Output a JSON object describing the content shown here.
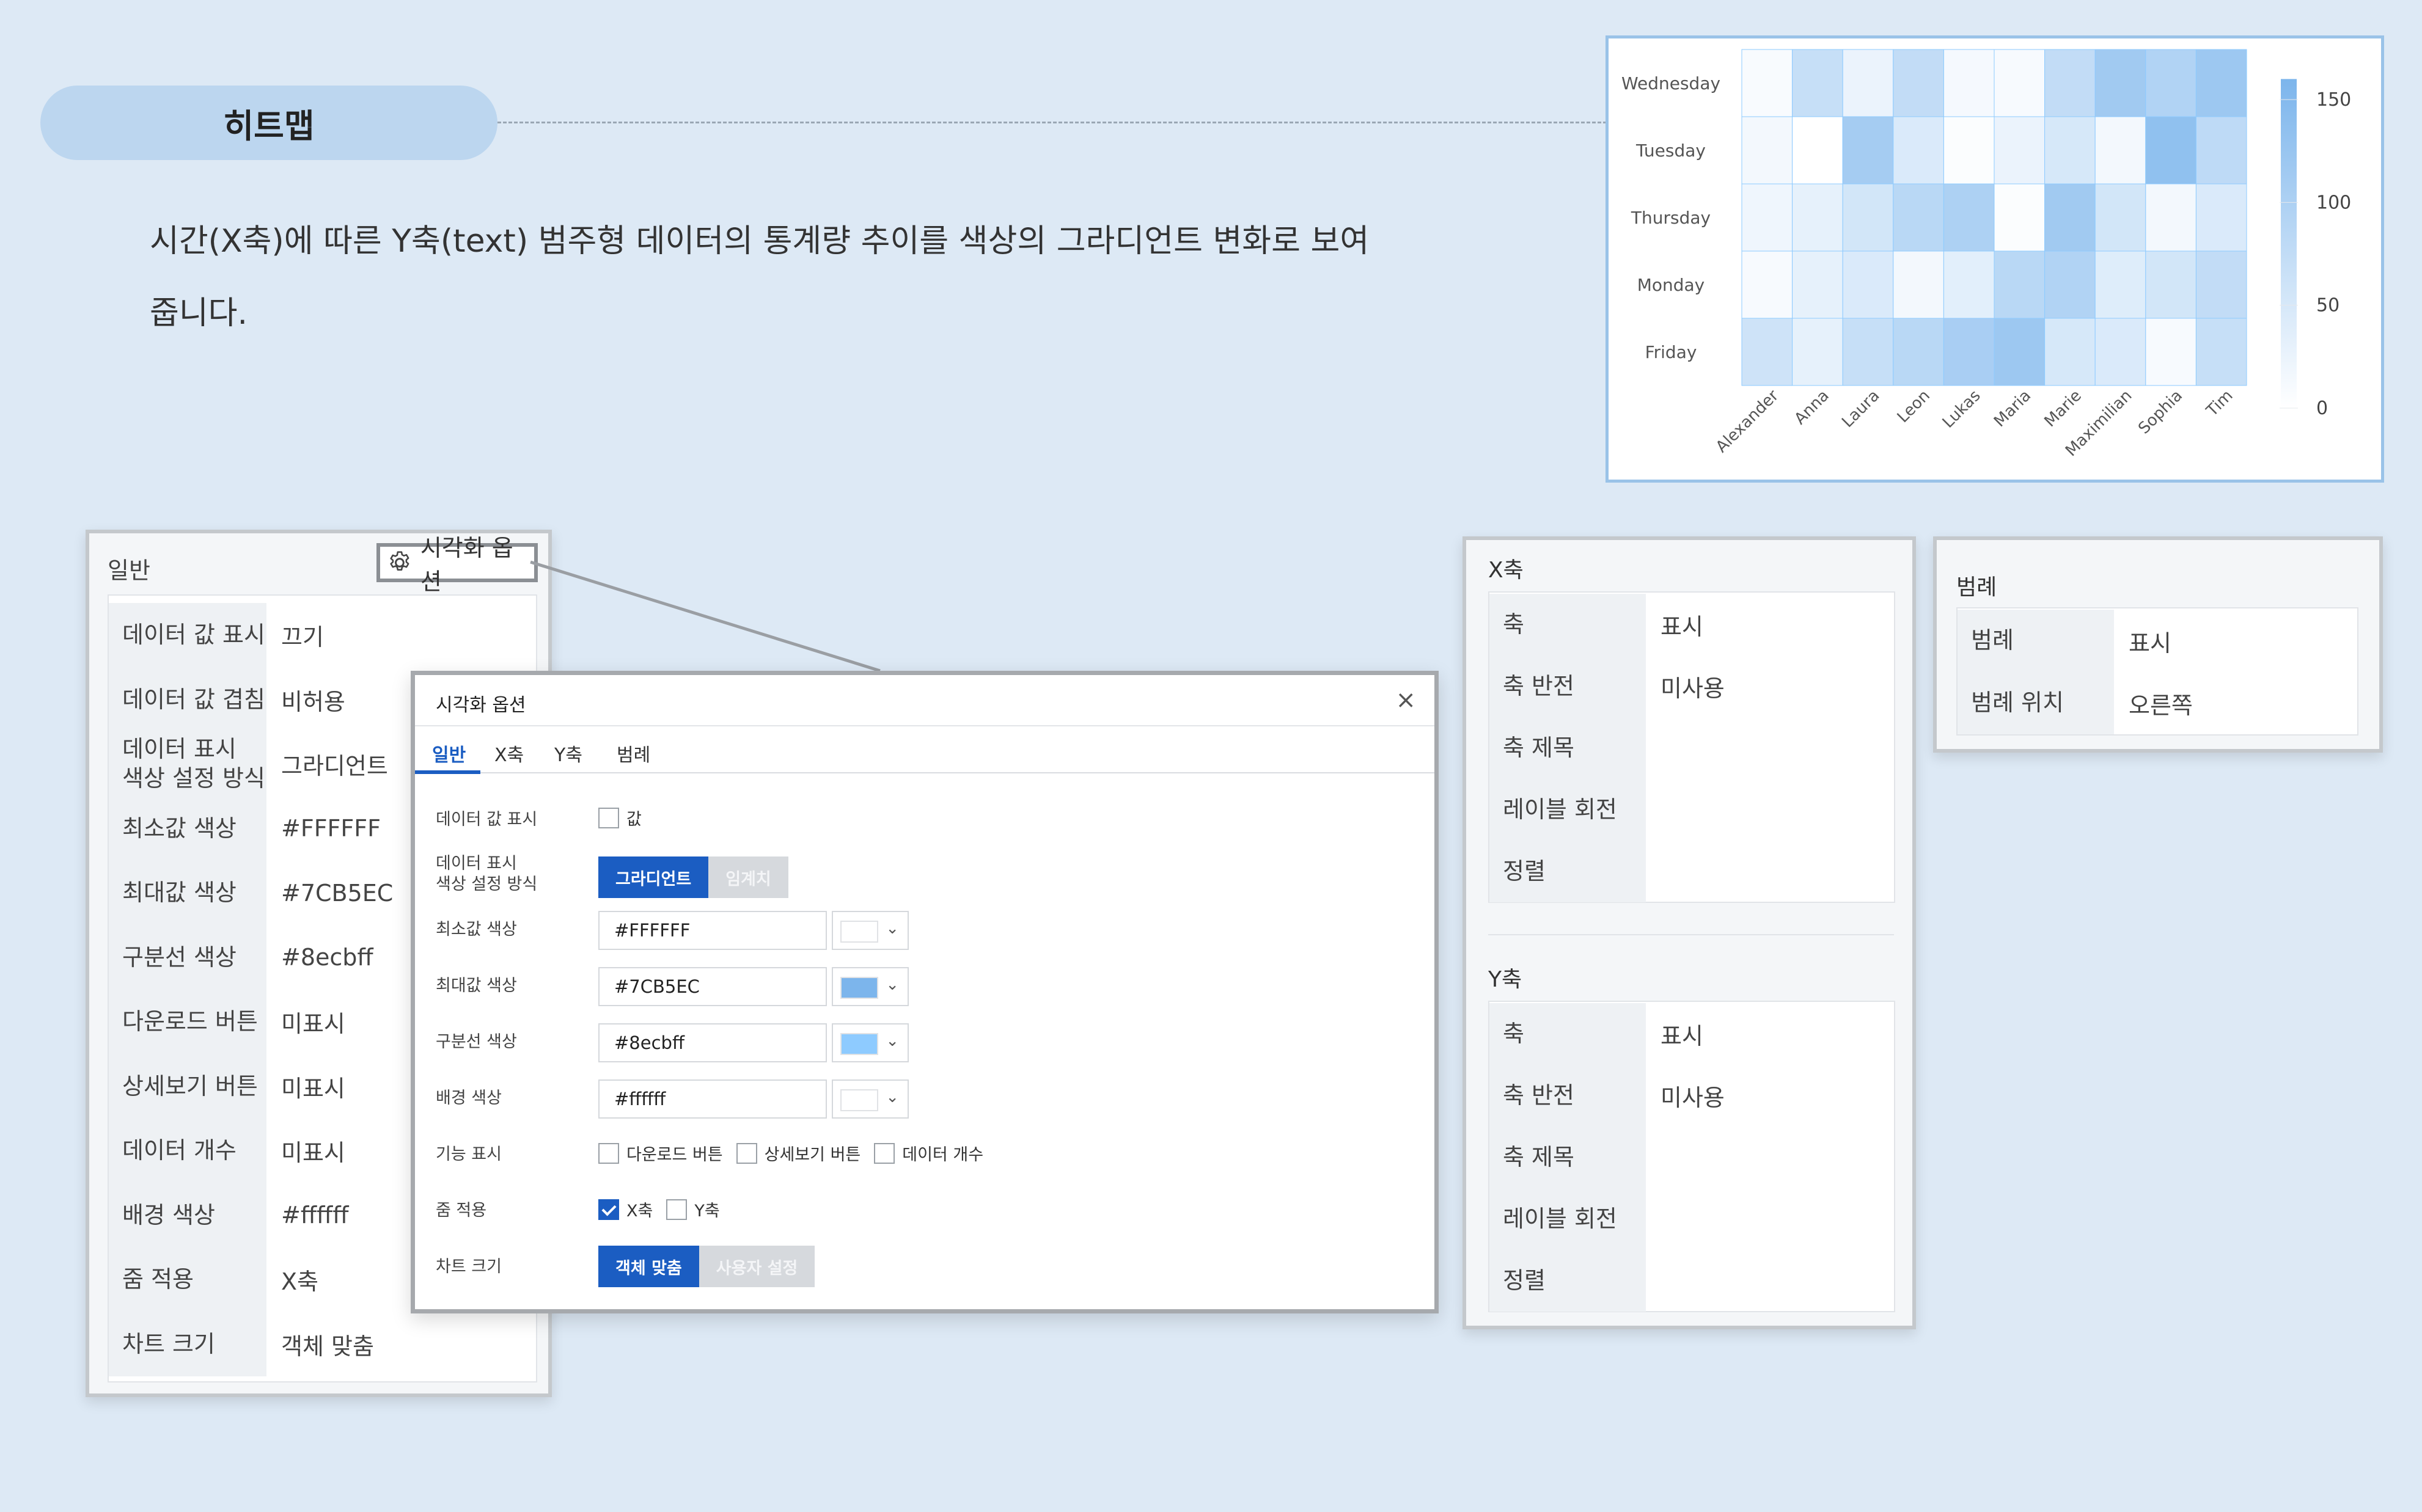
{
  "title": "히트맵",
  "description": {
    "line1": "시간(X축)에 따른 Y축(text) 범주형 데이터의 통계량 추이를 색상의 그라디언트 변화로 보여",
    "line2": "줍니다."
  },
  "chart_data": {
    "type": "heatmap",
    "x": [
      "Alexander",
      "Anna",
      "Laura",
      "Leon",
      "Lukas",
      "Maria",
      "Marie",
      "Maximilian",
      "Sophia",
      "Tim"
    ],
    "y": [
      "Wednesday",
      "Tuesday",
      "Thursday",
      "Monday",
      "Friday"
    ],
    "values": [
      [
        8,
        70,
        25,
        75,
        12,
        10,
        75,
        115,
        95,
        120
      ],
      [
        15,
        0,
        110,
        45,
        5,
        25,
        50,
        15,
        135,
        80
      ],
      [
        20,
        30,
        55,
        85,
        100,
        5,
        115,
        55,
        15,
        45
      ],
      [
        10,
        30,
        45,
        15,
        35,
        85,
        95,
        40,
        55,
        75
      ],
      [
        60,
        30,
        70,
        85,
        105,
        120,
        50,
        45,
        10,
        70
      ]
    ],
    "legend_ticks": [
      150,
      100,
      50,
      0
    ],
    "range": [
      0,
      160
    ],
    "min_color": "#FFFFFF",
    "max_color": "#7CB5EC",
    "legend_position": "right"
  },
  "general_panel": {
    "header": "일반",
    "option_button": "시각화 옵션",
    "rows": [
      {
        "label": "데이터 값 표시",
        "value": "끄기"
      },
      {
        "label": "데이터 값 겹침",
        "value": "비허용"
      },
      {
        "label": "데이터 표시\n색상 설정 방식",
        "value": "그라디언트"
      },
      {
        "label": "최소값 색상",
        "value": "#FFFFFF"
      },
      {
        "label": "최대값 색상",
        "value": "#7CB5EC"
      },
      {
        "label": "구분선 색상",
        "value": "#8ecbff"
      },
      {
        "label": "다운로드 버튼",
        "value": "미표시"
      },
      {
        "label": "상세보기 버튼",
        "value": "미표시"
      },
      {
        "label": "데이터 개수",
        "value": "미표시"
      },
      {
        "label": "배경 색상",
        "value": "#ffffff"
      },
      {
        "label": "줌 적용",
        "value": "X축"
      },
      {
        "label": "차트 크기",
        "value": "객체 맞춤"
      }
    ]
  },
  "dialog": {
    "title": "시각화 옵션",
    "close_icon": "×",
    "tabs": [
      "일반",
      "X축",
      "Y축",
      "범례"
    ],
    "active_tab": "일반",
    "show_value_label": "데이터 값 표시",
    "show_value_checkbox": "값",
    "color_mode_label": "데이터 표시\n색상 설정 방식",
    "color_mode_options": [
      "그라디언트",
      "임계치"
    ],
    "min_color_label": "최소값 색상",
    "min_color_value": "#FFFFFF",
    "max_color_label": "최대값 색상",
    "max_color_value": "#7CB5EC",
    "divider_color_label": "구분선 색상",
    "divider_color_value": "#8ecbff",
    "bg_color_label": "배경 색상",
    "bg_color_value": "#ffffff",
    "feature_label": "기능 표시",
    "feature_options": [
      "다운로드 버튼",
      "상세보기 버튼",
      "데이터 개수"
    ],
    "zoom_label": "줌 적용",
    "zoom_options": [
      "X축",
      "Y축"
    ],
    "chart_size_label": "차트 크기",
    "chart_size_options": [
      "객체 맞춤",
      "사용자 설정"
    ],
    "swatch_colors": [
      "#ffffff",
      "#7CB5EC",
      "#8ecbff",
      "#ffffff"
    ]
  },
  "x_axis_panel": {
    "title": "X축",
    "rows": [
      {
        "label": "축",
        "value": "표시"
      },
      {
        "label": "축 반전",
        "value": "미사용"
      },
      {
        "label": "축 제목",
        "value": ""
      },
      {
        "label": "레이블 회전",
        "value": ""
      },
      {
        "label": "정렬",
        "value": ""
      }
    ]
  },
  "y_axis_panel": {
    "title": "Y축",
    "rows": [
      {
        "label": "축",
        "value": "표시"
      },
      {
        "label": "축 반전",
        "value": "미사용"
      },
      {
        "label": "축 제목",
        "value": ""
      },
      {
        "label": "레이블 회전",
        "value": ""
      },
      {
        "label": "정렬",
        "value": ""
      }
    ]
  },
  "legend_panel": {
    "title": "범례",
    "rows": [
      {
        "label": "범례",
        "value": "표시"
      },
      {
        "label": "범례 위치",
        "value": "오른쪽"
      }
    ]
  }
}
